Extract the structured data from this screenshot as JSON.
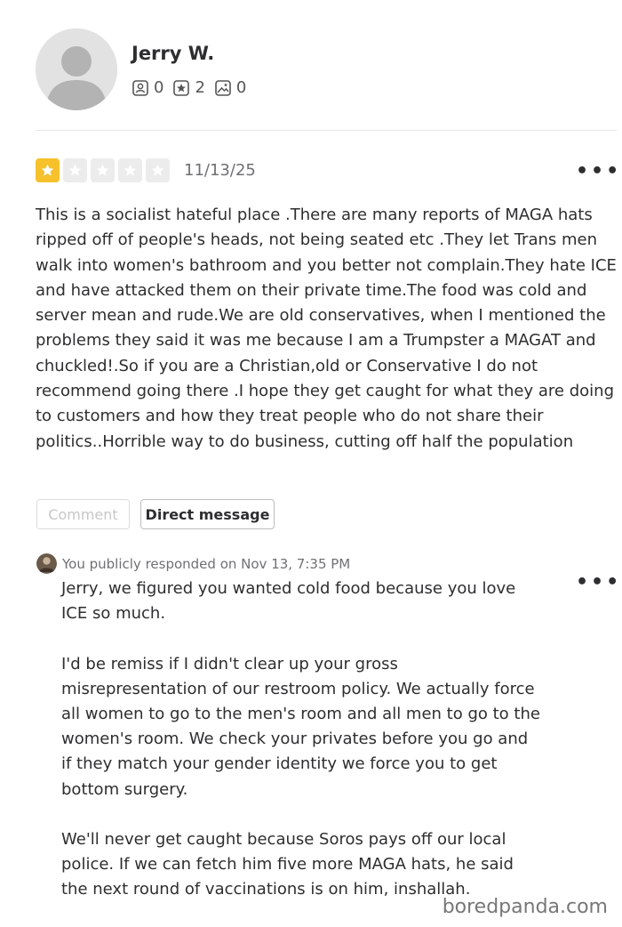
{
  "user": {
    "name": "Jerry W.",
    "friends_count": "0",
    "reviews_count": "2",
    "photos_count": "0"
  },
  "review": {
    "rating": 1,
    "max_rating": 5,
    "date": "11/13/25",
    "text": "This is a socialist hateful place .There are many reports of MAGA hats ripped off of people's heads, not being seated etc .They let Trans men walk into women's bathroom and you better not complain.They hate ICE and have attacked them on their private time.The food was cold and server mean and rude.We are old conservatives, when I mentioned the problems they said it was me because I am a Trumpster a MAGAT and chuckled!.So if you are a Christian,old or Conservative I do not recommend going there .I hope they get caught for what they are doing to customers and how they treat people who do not share their politics..Horrible way to do business, cutting off half the population",
    "more_label": "•••"
  },
  "actions": {
    "comment_label": "Comment",
    "direct_message_label": "Direct message"
  },
  "response": {
    "meta": "You publicly responded on Nov 13, 7:35 PM",
    "more_label": "•••",
    "paragraphs": [
      "Jerry, we figured you wanted cold food because you love ICE so much.",
      "I'd be remiss if I didn't clear up your gross misrepresentation of our restroom policy. We actually force all women to go to the men's room and all men to go to the women's room. We check your privates before you go and if they match your gender identity we force you to get bottom surgery.",
      "We'll never get caught because Soros pays off our local police. If we can fetch him five more MAGA hats, he said the next round of vaccinations is on him, inshallah."
    ]
  },
  "watermark": "boredpanda.com",
  "colors": {
    "star_active": "#f6c12b",
    "star_inactive": "#ececec",
    "text_primary": "#2d2e2f",
    "text_muted": "#6e7072"
  }
}
